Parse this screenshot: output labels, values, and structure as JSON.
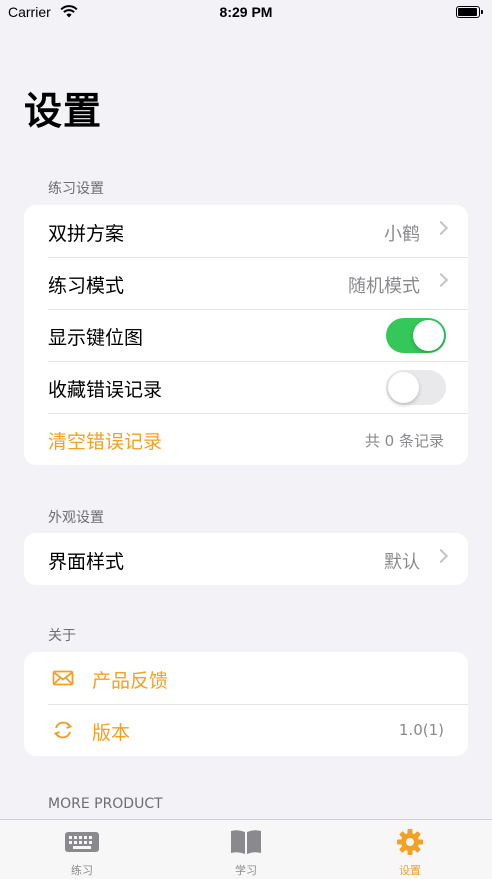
{
  "status_bar": {
    "carrier": "Carrier",
    "time": "8:29 PM"
  },
  "page_title": "设置",
  "sections": {
    "practice": {
      "header": "练习设置",
      "shuangpin_label": "双拼方案",
      "shuangpin_value": "小鹤",
      "mode_label": "练习模式",
      "mode_value": "随机模式",
      "keymap_label": "显示键位图",
      "keymap_on": true,
      "favorite_errors_label": "收藏错误记录",
      "favorite_errors_on": false,
      "clear_label": "清空错误记录",
      "clear_count": "共 0 条记录"
    },
    "appearance": {
      "header": "外观设置",
      "style_label": "界面样式",
      "style_value": "默认"
    },
    "about": {
      "header": "关于",
      "feedback_label": "产品反馈",
      "version_label": "版本",
      "version_value": "1.0(1)"
    },
    "more": {
      "header": "MORE PRODUCT"
    }
  },
  "tabbar": {
    "tabs": [
      {
        "label": "练习",
        "icon": "keyboard-icon"
      },
      {
        "label": "学习",
        "icon": "book-icon"
      },
      {
        "label": "设置",
        "icon": "gear-icon"
      }
    ],
    "active_index": 2
  },
  "colors": {
    "accent": "#f4a024",
    "toggle_on": "#34c759",
    "background": "#f2f2f7"
  }
}
